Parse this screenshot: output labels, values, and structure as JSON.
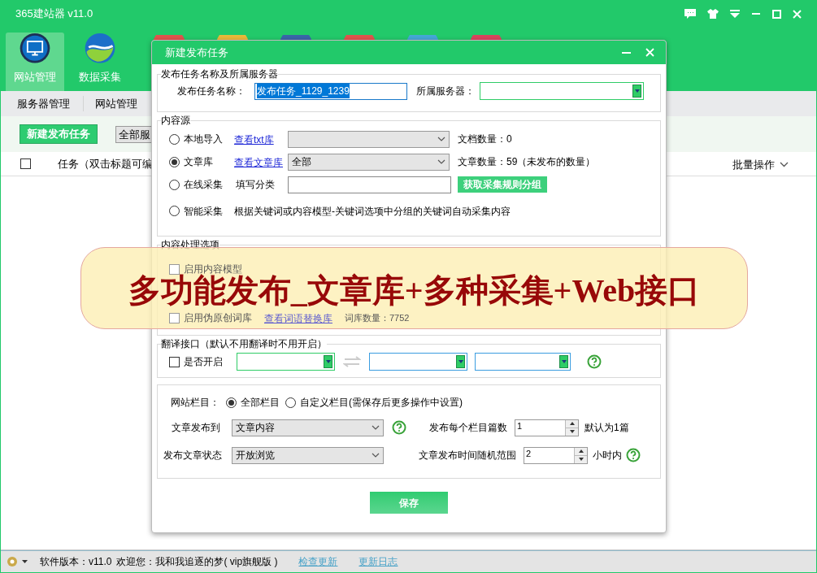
{
  "window": {
    "title": "365建站器 v11.0"
  },
  "nav": [
    {
      "label": "网站管理",
      "selected": true,
      "kind": "monitor"
    },
    {
      "label": "数据采集",
      "selected": false,
      "kind": "globe"
    }
  ],
  "subnav": [
    {
      "label": "服务器管理"
    },
    {
      "label": "网站管理"
    }
  ],
  "toolbar": {
    "new_button": "新建发布任务",
    "server_filter": "全部服"
  },
  "list_header": {
    "checked": false,
    "column_1": "任务（双击标题可编",
    "batch": "批量操作"
  },
  "dialog": {
    "title": "新建发布任务",
    "task_section": {
      "legend": "发布任务名称及所属服务器",
      "name_label": "发布任务名称：",
      "name_value": "发布任务_1129_1239",
      "server_label": "所属服务器："
    },
    "source_section": {
      "legend": "内容源",
      "options": [
        {
          "kind": "select",
          "label": "本地导入",
          "selected": false,
          "link": "查看txt库",
          "info": "文档数量：0"
        },
        {
          "kind": "select",
          "label": "文章库",
          "selected": true,
          "link": "查看文章库",
          "value": "全部",
          "info": "文章数量：59（未发布的数量）"
        },
        {
          "kind": "input",
          "label": "在线采集",
          "selected": false,
          "field_label": "填写分类",
          "button": "获取采集规则分组"
        },
        {
          "kind": "text",
          "label": "智能采集",
          "selected": false,
          "description": "根据关键词或内容模型-关键词选项中分组的关键词自动采集内容"
        }
      ]
    },
    "processing_section": {
      "legend": "内容处理选项",
      "options": [
        {
          "label": "启用内容模型",
          "checked": false
        },
        {
          "label": "启用伪原创词库",
          "checked": false,
          "link": "查看词语替换库",
          "info": "词库数量：7752"
        }
      ]
    },
    "translate_section": {
      "legend": "翻译接口（默认不用翻译时不用开启）",
      "enable_label": "是否开启",
      "checked": false
    },
    "publish_section": {
      "column_label": "网站栏目：",
      "column_options": [
        {
          "label": "全部栏目",
          "selected": true
        },
        {
          "label": "自定义栏目(需保存后更多操作中设置)",
          "selected": false
        }
      ],
      "publish_to_label": "文章发布到",
      "publish_to": "文章内容",
      "per_column_label": "发布每个栏目篇数",
      "per_column": "1",
      "per_column_hint": "默认为1篇",
      "status_label": "发布文章状态",
      "status": "开放浏览",
      "random_label": "文章发布时间随机范围",
      "random": "2",
      "random_hint": "小时内"
    },
    "save_button": "保存"
  },
  "banner": {
    "text": "多功能发布_文章库+多种采集+Web接口"
  },
  "status_bar": {
    "version": "软件版本：v11.0",
    "welcome": "欢迎您：我和我追逐的梦( vip旗舰版 )",
    "links": [
      "检查更新",
      "更新日志"
    ]
  }
}
